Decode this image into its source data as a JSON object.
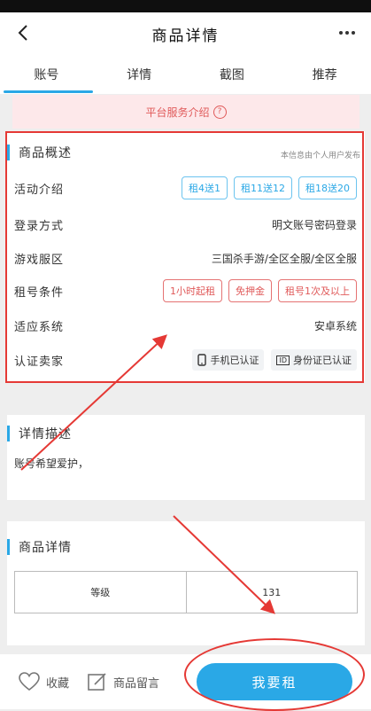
{
  "header": {
    "title": "商品详情"
  },
  "tabs": [
    {
      "label": "账号",
      "active": true
    },
    {
      "label": "详情"
    },
    {
      "label": "截图"
    },
    {
      "label": "推荐"
    }
  ],
  "notice": {
    "text": "平台服务介绍",
    "icon": "?"
  },
  "overview": {
    "title": "商品概述",
    "note": "本信息由个人用户发布",
    "activity_label": "活动介绍",
    "activity_tags": [
      "租4送1",
      "租11送12",
      "租18送20"
    ],
    "login_label": "登录方式",
    "login_value": "明文账号密码登录",
    "server_label": "游戏服区",
    "server_value": "三国杀手游/全区全服/全区全服",
    "rent_label": "租号条件",
    "rent_tags": [
      "1小时起租",
      "免押金",
      "租号1次及以上"
    ],
    "system_label": "适应系统",
    "system_value": "安卓系统",
    "verify_label": "认证卖家",
    "verify_phone": "手机已认证",
    "verify_id": "身份证已认证",
    "id_icon": "ID"
  },
  "description": {
    "title": "详情描述",
    "text": "账号希望爱护，"
  },
  "details": {
    "title": "商品详情",
    "rows": [
      {
        "key": "等级",
        "value": "131"
      }
    ]
  },
  "bottom": {
    "favorite": "收藏",
    "message": "商品留言",
    "rent": "我要租"
  },
  "colors": {
    "accent": "#2aa8e6",
    "annotation": "#e53935"
  }
}
